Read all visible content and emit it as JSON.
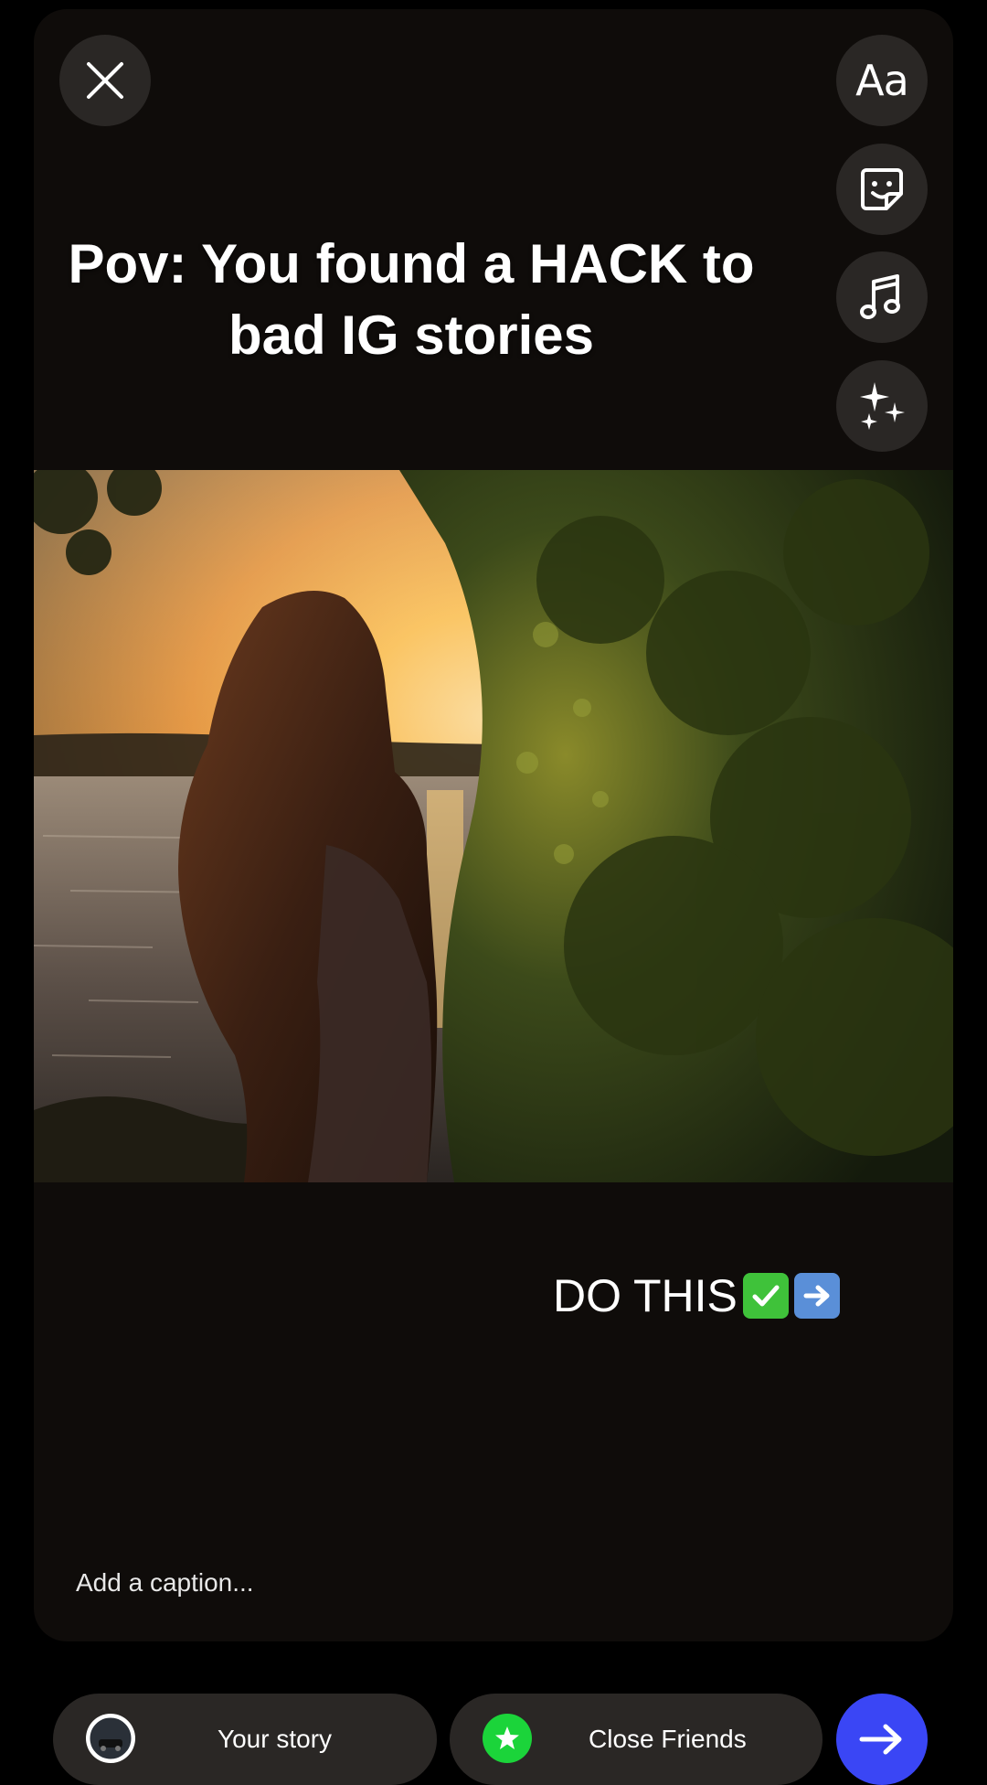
{
  "editor": {
    "headline_line1": "Pov: You found a HACK to",
    "headline_line2": "bad IG stories",
    "overlay_text": "DO THIS",
    "overlay_emoji": [
      "check-mark-button-emoji",
      "right-arrow-emoji"
    ],
    "caption_placeholder": "Add a caption..."
  },
  "tools": {
    "text_label": "Aa",
    "icons": [
      "close-icon",
      "text-icon",
      "sticker-icon",
      "music-icon",
      "effects-icon",
      "chevron-down-icon"
    ]
  },
  "share": {
    "your_story_label": "Your story",
    "close_friends_label": "Close Friends",
    "send_icon": "arrow-right-icon"
  },
  "colors": {
    "canvas_bg": "#0f0c0a",
    "button_bg": "#2a2725",
    "close_friends_green": "#1bd43a",
    "send_blue": "#3a46f5"
  }
}
